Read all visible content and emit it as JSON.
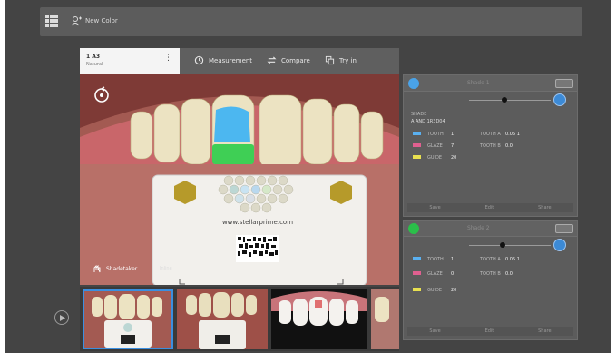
{
  "topbar": {
    "new_color_label": "New Color"
  },
  "shade_card": {
    "name": "1 A3",
    "subtitle": "Natural"
  },
  "tabs": [
    {
      "label": "Measurement"
    },
    {
      "label": "Compare"
    },
    {
      "label": "Try in"
    }
  ],
  "guide": {
    "url": "www.stellarprime.com"
  },
  "overlay": {
    "label": "Shadetaker",
    "mode": "Inline"
  },
  "card1": {
    "title": "Shade 1",
    "fields": [
      {
        "label": "TOOTH",
        "value": "1"
      },
      {
        "label": "GLAZE",
        "value": "7"
      },
      {
        "label": "TOOTH A",
        "value": "0.05 1"
      },
      {
        "label": "TOOTH B",
        "value": "0.0"
      },
      {
        "label": "GUIDE",
        "value": "20"
      },
      {
        "label": "SHADE",
        "value": "A AND 1R3D04"
      }
    ],
    "actions": [
      "Save",
      "Edit",
      "Share"
    ]
  },
  "card2": {
    "title": "Shade 2",
    "fields": [
      {
        "label": "TOOTH",
        "value": "1"
      },
      {
        "label": "GLAZE",
        "value": "0"
      },
      {
        "label": "TOOTH A",
        "value": "0.05 1"
      },
      {
        "label": "TOOTH B",
        "value": "0.0"
      },
      {
        "label": "GUIDE",
        "value": "20"
      }
    ],
    "actions": [
      "Save",
      "Edit",
      "Share"
    ]
  },
  "colors": {
    "accent": "#3b8fe0",
    "card1_dot": "#4aa3e8",
    "card2_dot": "#2bbf4a",
    "swatch_blue": "#5ab0f0",
    "swatch_pink": "#e06090",
    "swatch_yellow": "#e8e050"
  }
}
